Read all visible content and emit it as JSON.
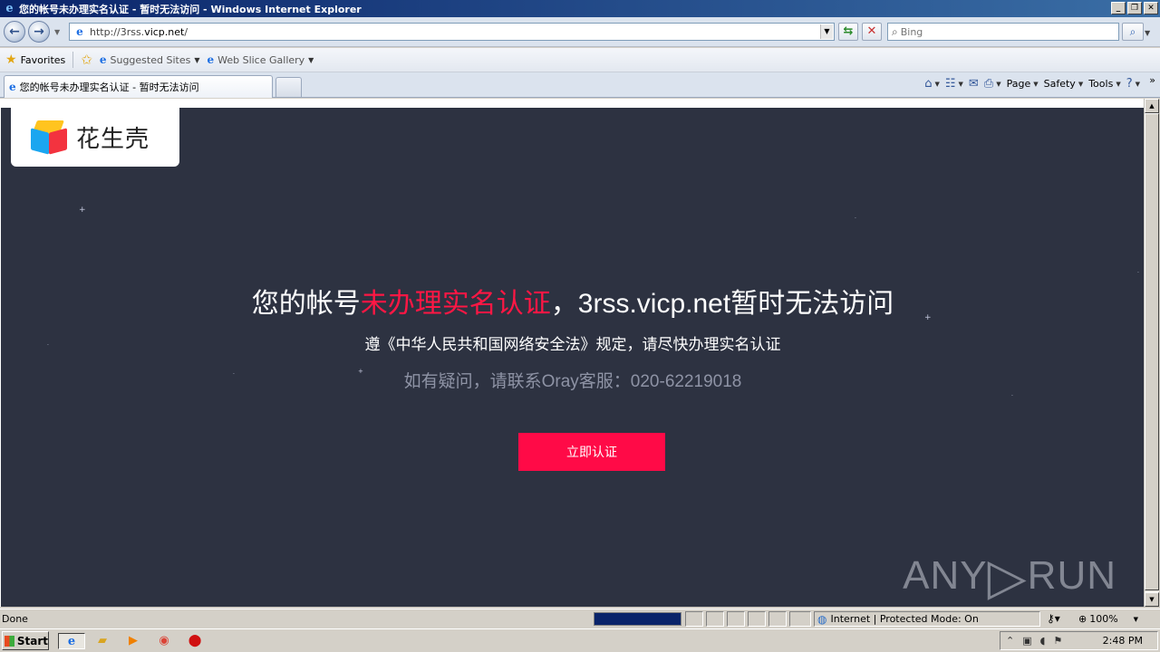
{
  "window": {
    "title": "您的帐号未办理实名认证 - 暂时无法访问 - Windows Internet Explorer",
    "min_label": "_",
    "max_label": "❐",
    "close_label": "✕"
  },
  "address_bar": {
    "url_prefix": "http://3rss.",
    "url_host": "vicp.net",
    "url_suffix": "/"
  },
  "search": {
    "placeholder": "Bing"
  },
  "favorites_bar": {
    "favorites_label": "Favorites",
    "items": [
      {
        "label": "Suggested Sites"
      },
      {
        "label": "Web Slice Gallery"
      }
    ]
  },
  "tabs": [
    {
      "label": "您的帐号未办理实名认证 - 暂时无法访问"
    }
  ],
  "command_bar": {
    "page_label": "Page",
    "safety_label": "Safety",
    "tools_label": "Tools"
  },
  "page": {
    "logo_text": "花生壳",
    "headline_part1": "您的帐号",
    "headline_highlight": "未办理实名认证",
    "headline_part2": "，3rss.vicp.net暂时无法访问",
    "subline": "遵《中华人民共和国网络安全法》规定，请尽快办理实名认证",
    "contact": "如有疑问，请联系Oray客服：020-62219018",
    "verify_button": "立即认证",
    "watermark_left": "ANY",
    "watermark_right": "RUN",
    "accent_color": "#ff0a47",
    "background_color": "#2d3241"
  },
  "status_bar": {
    "status_text": "Done",
    "zone_text": "Internet | Protected Mode: On",
    "zoom": "100%",
    "progress": 1.0
  },
  "taskbar": {
    "start_label": "Start",
    "clock": "2:48 PM"
  }
}
